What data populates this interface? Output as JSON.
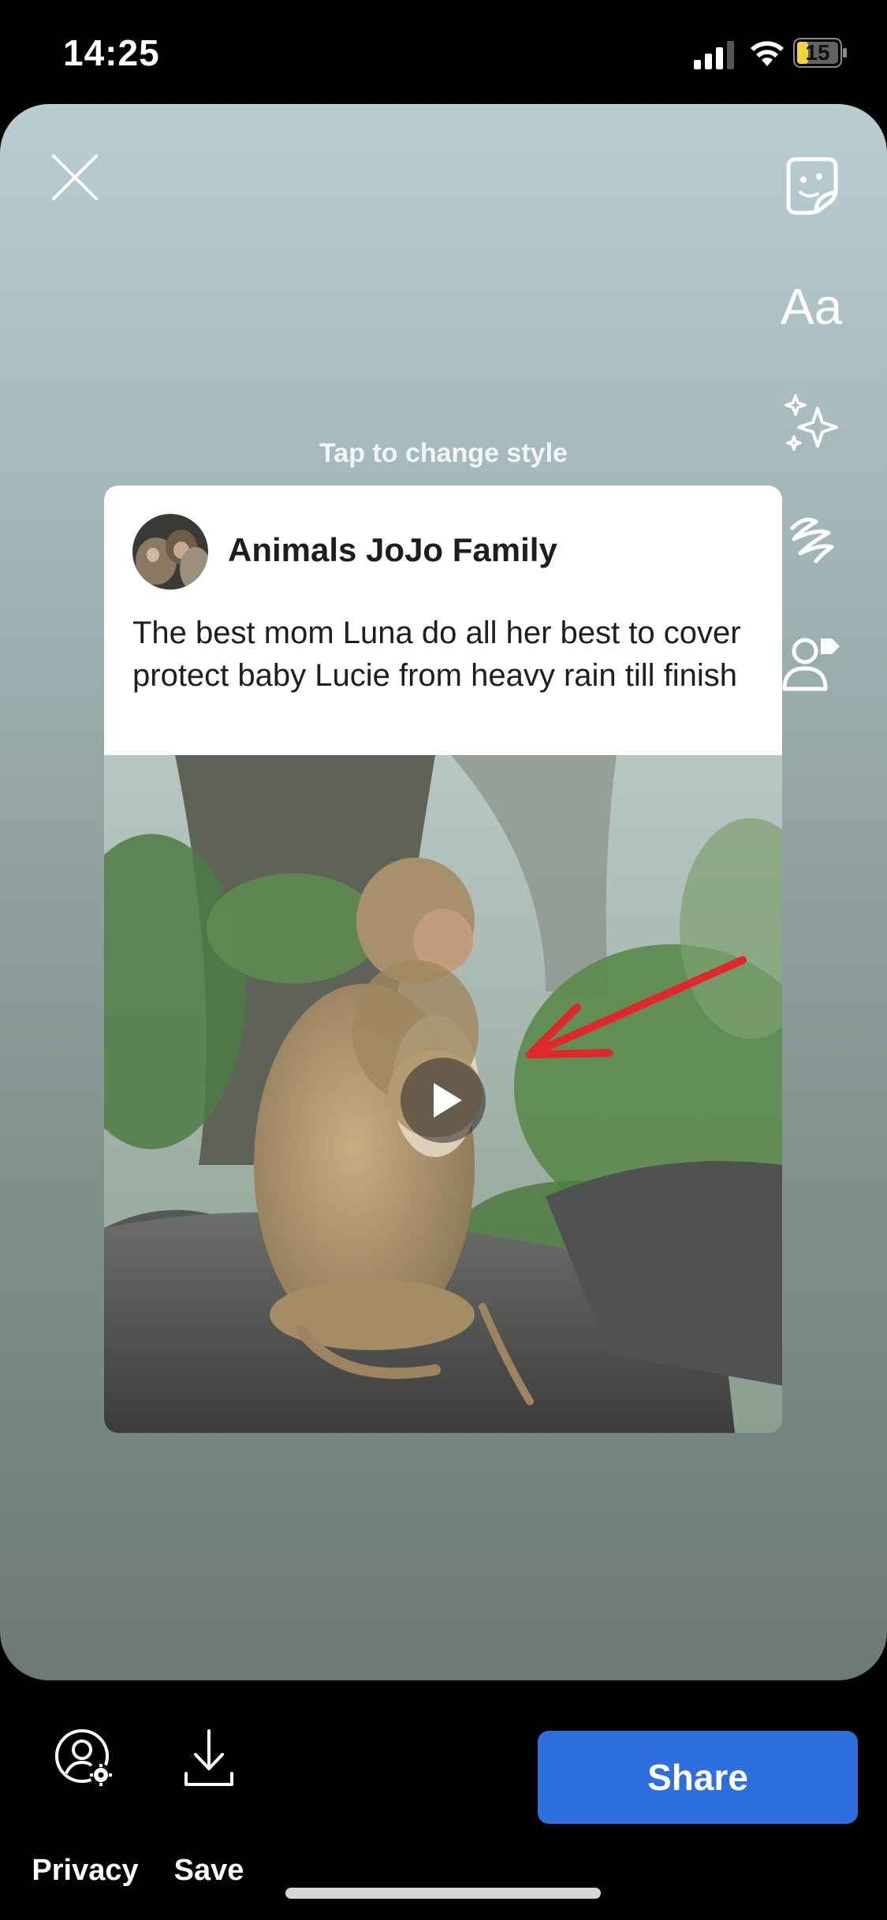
{
  "status_bar": {
    "time": "14:25",
    "battery": "15"
  },
  "story": {
    "hint": "Tap to change style",
    "text_tool_label": "Aa"
  },
  "post": {
    "author": "Animals JoJo Family",
    "caption": "The best mom Luna do all her best to cover protect baby Lucie from heavy rain till finish"
  },
  "bottom_bar": {
    "privacy_label": "Privacy",
    "save_label": "Save",
    "share_label": "Share"
  },
  "colors": {
    "share_button": "#2f6fdd",
    "background": "#000000",
    "arrow": "#e0282a"
  }
}
